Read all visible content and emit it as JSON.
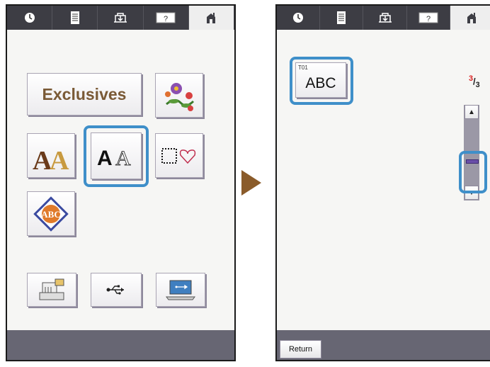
{
  "left_screen": {
    "categories": {
      "exclusives_label": "Exclusives",
      "monogram_text": "ABC",
      "font_sample_1": "AA",
      "font_sample_2": "AA"
    }
  },
  "right_screen": {
    "pattern": {
      "code": "T01",
      "label": "ABC"
    },
    "page_indicator": {
      "current": "3",
      "total": "3"
    },
    "scroll": {
      "up": "▲",
      "down": "▼"
    },
    "return_label": "Return"
  },
  "tabs": [
    "clock-icon",
    "document-icon",
    "sewing-machine-icon",
    "help-icon",
    "home-icon"
  ],
  "colors": {
    "accent_highlight": "#3f8fc9",
    "bar": "#3d3d44",
    "bottom_bar": "#676673",
    "arrow": "#8a5b2a"
  }
}
